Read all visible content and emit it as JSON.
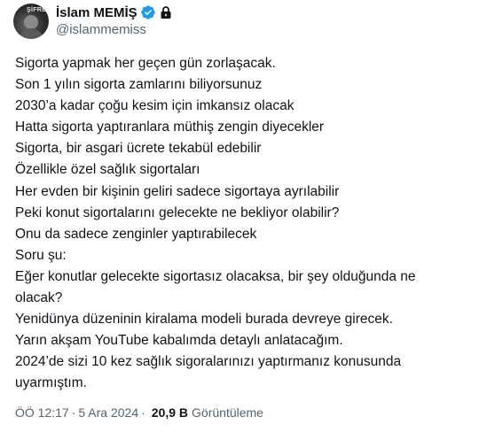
{
  "author": {
    "display_name": "İslam MEMİŞ",
    "handle": "@islammemiss",
    "avatar_text": "ŞİFRE",
    "verified_color": "#1d9bf0"
  },
  "tweet": {
    "lines": [
      "Sigorta yapmak her geçen gün zorlaşacak.",
      "Son 1 yılın sigorta zamlarını biliyorsunuz",
      "2030’a kadar çoğu kesim için imkansız olacak",
      "Hatta sigorta yaptıranlara müthiş zengin diyecekler",
      "Sigorta, bir asgari ücrete tekabül edebilir",
      "Özellikle özel sağlık sigortaları",
      "Her evden bir kişinin geliri sadece sigortaya ayrılabilir",
      "Peki konut sigortalarını gelecekte ne bekliyor olabilir?",
      "Onu da sadece zenginler yaptırabilecek",
      "Soru şu:",
      "Eğer konutlar gelecekte sigortasız olacaksa, bir şey olduğunda ne",
      "olacak?",
      "Yenidünya düzeninin kiralama modeli burada devreye girecek.",
      "Yarın akşam YouTube kabalımda detaylı anlatacağım.",
      "2024’de sizi 10 kez sağlık sigoralarınızı yaptırmanız konusunda",
      "uyarmıştım."
    ]
  },
  "meta": {
    "time": "ÖÖ 12:17",
    "separator1": "·",
    "date": "5 Ara 2024",
    "separator2": "·",
    "views_count": "20,9 B",
    "views_label": "Görüntüleme"
  }
}
